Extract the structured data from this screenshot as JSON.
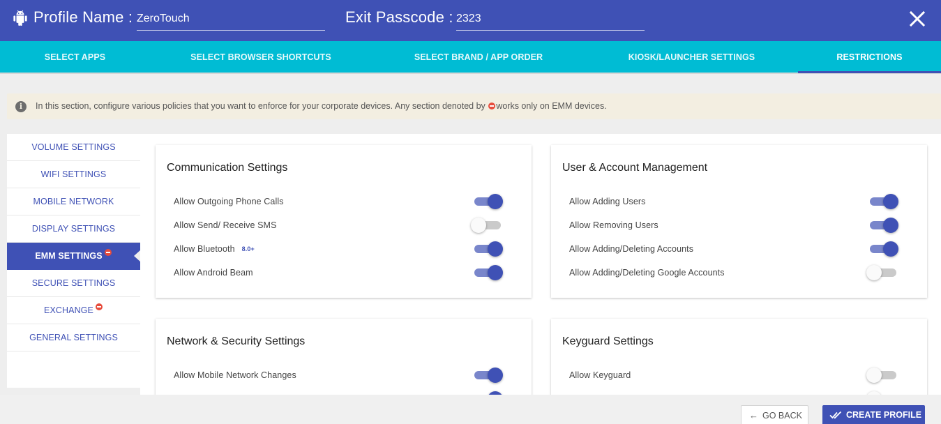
{
  "header": {
    "profile_name_label": "Profile Name :",
    "profile_name_value": "ZeroTouch",
    "exit_passcode_label": "Exit Passcode :",
    "exit_passcode_value": "2323"
  },
  "tabs": [
    {
      "label": "SELECT APPS"
    },
    {
      "label": "SELECT BROWSER SHORTCUTS"
    },
    {
      "label": "SELECT BRAND / APP ORDER"
    },
    {
      "label": "KIOSK/LAUNCHER SETTINGS"
    },
    {
      "label": "RESTRICTIONS",
      "active": true
    }
  ],
  "info": {
    "text_before": "In this section, configure various policies that you want to enforce for your corporate devices. Any section denoted by",
    "text_after": "works only on EMM devices."
  },
  "sidebar": {
    "items": [
      {
        "label": "VOLUME SETTINGS"
      },
      {
        "label": "WIFI SETTINGS"
      },
      {
        "label": "MOBILE NETWORK"
      },
      {
        "label": "DISPLAY SETTINGS"
      },
      {
        "label": "EMM SETTINGS",
        "active": true,
        "emm": true
      },
      {
        "label": "SECURE SETTINGS"
      },
      {
        "label": "EXCHANGE",
        "emm": true
      },
      {
        "label": "GENERAL SETTINGS"
      }
    ]
  },
  "cards": {
    "communication": {
      "title": "Communication Settings",
      "rows": [
        {
          "label": "Allow Outgoing Phone Calls",
          "on": true
        },
        {
          "label": "Allow Send/ Receive SMS",
          "on": false
        },
        {
          "label": "Allow Bluetooth",
          "version": "8.0+",
          "on": true
        },
        {
          "label": "Allow Android Beam",
          "on": true
        }
      ]
    },
    "user_account": {
      "title": "User & Account Management",
      "rows": [
        {
          "label": "Allow Adding Users",
          "on": true
        },
        {
          "label": "Allow Removing Users",
          "on": true
        },
        {
          "label": "Allow Adding/Deleting Accounts",
          "on": true
        },
        {
          "label": "Allow Adding/Deleting Google Accounts",
          "on": false
        }
      ]
    },
    "network_security": {
      "title": "Network & Security Settings",
      "rows": [
        {
          "label": "Allow Mobile Network Changes",
          "on": true
        }
      ]
    },
    "keyguard": {
      "title": "Keyguard Settings",
      "rows": [
        {
          "label": "Allow Keyguard",
          "on": false
        }
      ]
    }
  },
  "footer": {
    "back_label": "GO BACK",
    "create_label": "CREATE PROFILE"
  },
  "colors": {
    "primary": "#3f51b5",
    "tabs_bg": "#00bcd4",
    "emm_badge": "#e74c3c",
    "info_bg": "#f3eee1"
  }
}
